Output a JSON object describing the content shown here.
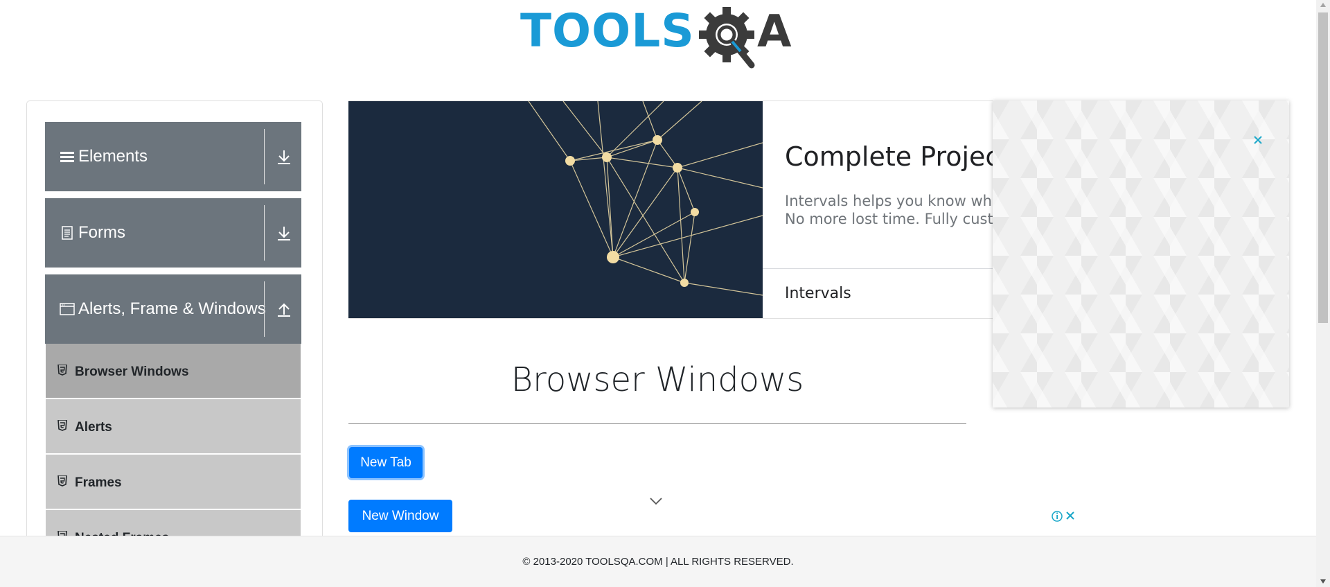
{
  "header": {
    "logo_text_primary": "TOOLS",
    "logo_text_secondary": "A",
    "logo_colors": {
      "primary": "#1a9ad6",
      "secondary": "#3b3b3b"
    }
  },
  "sidebar": {
    "groups": [
      {
        "label": "Elements",
        "icon": "menu-icon",
        "arrow_icon": "download-arrow-icon"
      },
      {
        "label": "Forms",
        "icon": "document-icon",
        "arrow_icon": "download-arrow-icon"
      },
      {
        "label": "Alerts, Frame & Windows",
        "icon": "window-icon",
        "arrow_icon": "upload-arrow-icon"
      }
    ],
    "items": [
      {
        "label": "Browser Windows",
        "icon": "html5-icon",
        "active": true
      },
      {
        "label": "Alerts",
        "icon": "html5-icon",
        "active": false
      },
      {
        "label": "Frames",
        "icon": "html5-icon",
        "active": false
      },
      {
        "label": "Nested Frames",
        "icon": "html5-icon",
        "active": false
      }
    ],
    "colors": {
      "group_bg": "#6c757d",
      "item_bg": "#c8c8c8",
      "item_active_bg": "#a9a9a9"
    }
  },
  "banner": {
    "title": "Complete Project",
    "desc_line1": "Intervals helps you know wher",
    "desc_line2": "No more lost time. Fully custo",
    "brand": "Intervals",
    "dark_bg": "#1b2a3e"
  },
  "ad_overlay": {
    "close_icon": "close-icon"
  },
  "main": {
    "title": "Browser Windows",
    "buttons": {
      "new_tab": "New Tab",
      "new_window": "New Window"
    },
    "accent": "#007bff"
  },
  "footer": {
    "text": "© 2013-2020 TOOLSQA.COM | ALL RIGHTS RESERVED."
  }
}
